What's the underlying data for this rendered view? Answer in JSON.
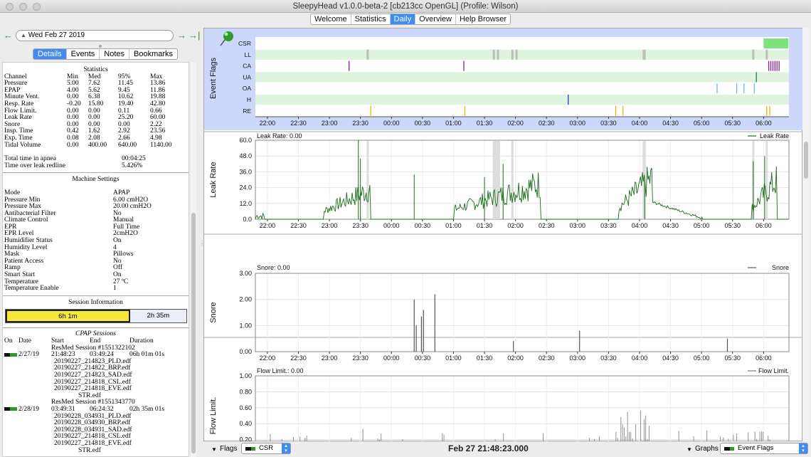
{
  "window": {
    "title": "SleepyHead v1.0.0-beta-2 [cb213cc OpenGL] (Profile: Wilson)"
  },
  "nav_tabs": [
    {
      "label": "Welcome",
      "active": false
    },
    {
      "label": "Statistics",
      "active": false
    },
    {
      "label": "Daily",
      "active": true
    },
    {
      "label": "Overview",
      "active": false
    },
    {
      "label": "Help Browser",
      "active": false
    }
  ],
  "date_nav": {
    "date": "Wed Feb 27 2019",
    "back_icon": "back-arrow-icon",
    "forward_icon": "forward-arrow-icon",
    "last_icon": "jump-to-last-icon"
  },
  "left_tabs": [
    {
      "label": "Details",
      "active": true
    },
    {
      "label": "Events",
      "active": false
    },
    {
      "label": "Notes",
      "active": false
    },
    {
      "label": "Bookmarks",
      "active": false
    }
  ],
  "statistics": {
    "heading": "Statistics",
    "columns": [
      "Channel",
      "Min",
      "Med",
      "95%",
      "Max"
    ],
    "rows": [
      [
        "Pressure",
        "5.00",
        "7.62",
        "11.45",
        "13.86"
      ],
      [
        "EPAP",
        "4.00",
        "5.62",
        "9.45",
        "11.86"
      ],
      [
        "Minute Vent.",
        "0.00",
        "6.38",
        "10.62",
        "19.88"
      ],
      [
        "Resp. Rate",
        "-0.20",
        "15.80",
        "19.40",
        "42.80"
      ],
      [
        "Flow Limit.",
        "0.00",
        "0.00",
        "0.11",
        "0.66"
      ],
      [
        "Leak Rate",
        "0.00",
        "0.00",
        "25.20",
        "60.00"
      ],
      [
        "Snore",
        "0.00",
        "0.00",
        "0.00",
        "2.22"
      ],
      [
        "Insp. Time",
        "0.42",
        "1.62",
        "2.92",
        "23.56"
      ],
      [
        "Exp. Time",
        "0.08",
        "2.08",
        "2.66",
        "4.98"
      ],
      [
        "Tidal Volume",
        "0.00",
        "400.00",
        "640.00",
        "1140.00"
      ]
    ],
    "summary": [
      [
        "Total time in apnea",
        "00:04:25"
      ],
      [
        "Time over leak redline",
        "5.426%"
      ]
    ]
  },
  "machine_settings": {
    "heading": "Machine Settings",
    "rows": [
      [
        "Mode",
        "APAP"
      ],
      [
        "Pressure Min",
        "6.00 cmH2O"
      ],
      [
        "Pressure Max",
        "20.00 cmH2O"
      ],
      [
        "Antibacterial Filter",
        "No"
      ],
      [
        "Climate Control",
        "Manual"
      ],
      [
        "EPR",
        "Full Time"
      ],
      [
        "EPR Level",
        "2cmH2O"
      ],
      [
        "Humidifier Status",
        "On"
      ],
      [
        "Humidity Level",
        "4"
      ],
      [
        "Mask",
        "Pillows"
      ],
      [
        "Patient Access",
        "No"
      ],
      [
        "Ramp",
        "Off"
      ],
      [
        "Smart Start",
        "On"
      ],
      [
        "Temperature",
        "27 ºC"
      ],
      [
        "Temperature Enable",
        "1"
      ]
    ]
  },
  "session_info": {
    "heading": "Session Information",
    "bar_segments": [
      {
        "label": "6h 1m",
        "fraction": 0.688
      },
      {
        "label": "2h 35m",
        "fraction": 0.312
      }
    ]
  },
  "cpap_sessions": {
    "heading": "CPAP Sessions",
    "columns": [
      "On",
      "Date",
      "Start",
      "End",
      "Duration"
    ],
    "sessions": [
      {
        "date": "2/27/19",
        "title": "ResMed Session #1551322102",
        "start": "21:48:23",
        "end": "03:49:24",
        "duration": "06h 01m 01s",
        "files": [
          "20190227_214823_PLD.edf",
          "20190227_214822_BRP.edf",
          "20190227_214823_SAD.edf",
          "20190227_214818_CSL.edf",
          "20190227_214818_EVE.edf",
          "STR.edf"
        ]
      },
      {
        "date": "2/28/19",
        "title": "ResMed Session #1551343770",
        "start": "03:49:31",
        "end": "06:24:32",
        "duration": "02h 35m 01s",
        "files": [
          "20190228_034931_PLD.edf",
          "20190228_034930_BRP.edf",
          "20190228_034931_SAD.edf",
          "20190227_214818_CSL.edf",
          "20190227_214818_EVE.edf",
          "STR.edf"
        ]
      }
    ]
  },
  "time_axis_labels": [
    "22:00",
    "22:30",
    "23:00",
    "23:30",
    "00:00",
    "00:30",
    "01:00",
    "01:30",
    "02:00",
    "02:30",
    "03:00",
    "03:30",
    "04:00",
    "04:30",
    "05:00",
    "05:30",
    "06:00"
  ],
  "event_flags": {
    "ylabel": "Event Flags",
    "channels": [
      "CSR",
      "LL",
      "CA",
      "UA",
      "OA",
      "H",
      "RE"
    ],
    "colors": {
      "CSR": "#7ee37e",
      "LL": "#bdbdbd",
      "CA": "#8b1a8b",
      "UA": "#1e7d4a",
      "OA": "#6fb7e6",
      "H": "#2a3ab8",
      "RE": "#f0b400"
    },
    "icon": "pushpin-icon"
  },
  "leak_graph": {
    "ylabel": "Leak Rate",
    "header": "Leak Rate: 0.00",
    "legend": "Leak Rate"
  },
  "snore_graph": {
    "ylabel": "Snore",
    "header": "Snore: 0.00",
    "legend": "Snore"
  },
  "flow_graph": {
    "ylabel": "Flow Limit.",
    "header": "Flow Limit.: 0.00",
    "legend": "Flow Limit."
  },
  "chart_data": [
    {
      "type": "line",
      "name": "Leak Rate",
      "x_range": [
        "21:48:23",
        "06:24:32"
      ],
      "ylim": [
        0,
        60
      ],
      "yticks": [
        "0.0",
        "12.0",
        "24.0",
        "36.0",
        "48.0",
        "60.0"
      ],
      "series": [
        {
          "name": "Leak Rate",
          "color": "#1a6e1a"
        }
      ]
    },
    {
      "type": "bar",
      "name": "Snore",
      "ylim": [
        0,
        3
      ],
      "yticks": [
        "0.00",
        "1.00",
        "2.00",
        "3.00"
      ],
      "series": [
        {
          "name": "Snore",
          "color": "#555555",
          "points": [
            [
              "00:22",
              2.0
            ],
            [
              "00:24",
              1.0
            ],
            [
              "00:29",
              1.35
            ],
            [
              "00:31",
              1.6
            ],
            [
              "00:42",
              2.2
            ],
            [
              "01:58",
              0.4
            ],
            [
              "03:02",
              0.8
            ],
            [
              "05:25",
              0.5
            ]
          ]
        }
      ]
    },
    {
      "type": "line",
      "name": "Flow Limit.",
      "ylim": [
        0,
        1
      ],
      "yticks": [
        "0.00",
        "0.20",
        "0.40",
        "0.60",
        "0.80",
        "1.00"
      ],
      "series": [
        {
          "name": "Flow Limit.",
          "color": "#777777"
        }
      ]
    }
  ],
  "bottom": {
    "flags_label": "Flags",
    "flags_value": "CSR",
    "timestamp": "Feb 27 21:48:23.000",
    "graphs_label": "Graphs",
    "graphs_value": "Event Flags"
  }
}
